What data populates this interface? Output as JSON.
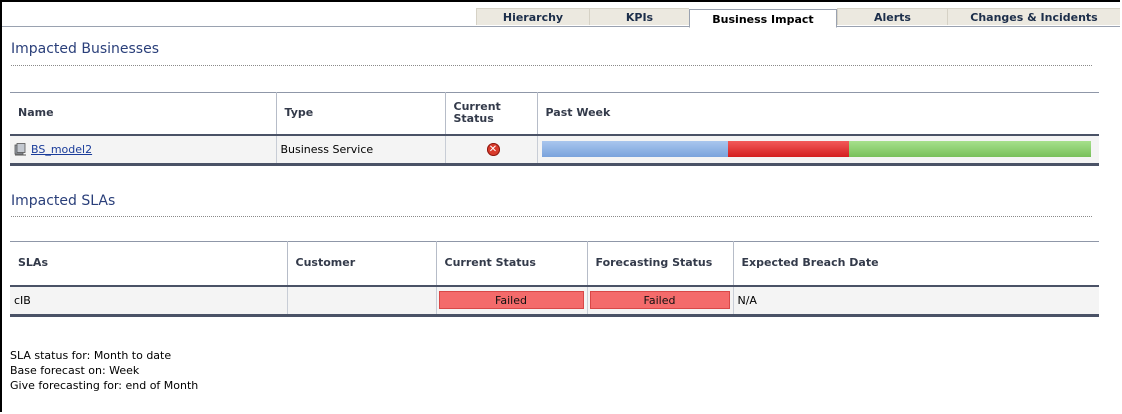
{
  "tabs": [
    {
      "label": "Hierarchy",
      "active": false
    },
    {
      "label": "KPIs",
      "active": false
    },
    {
      "label": "Business Impact",
      "active": true
    },
    {
      "label": "Alerts",
      "active": false
    },
    {
      "label": "Changes & Incidents",
      "active": false
    }
  ],
  "businesses": {
    "title": "Impacted Businesses",
    "columns": {
      "name": "Name",
      "type": "Type",
      "current_status": "Current Status",
      "past_week": "Past Week"
    },
    "rows": [
      {
        "name": "BS_model2",
        "type": "Business Service",
        "current_status_icon": "failed-x-icon",
        "past_week": [
          {
            "status": "blue",
            "fraction": 0.34
          },
          {
            "status": "red",
            "fraction": 0.22
          },
          {
            "status": "green",
            "fraction": 0.44
          }
        ]
      }
    ]
  },
  "slas": {
    "title": "Impacted SLAs",
    "columns": {
      "slas": "SLAs",
      "customer": "Customer",
      "current_status": "Current Status",
      "forecasting_status": "Forecasting Status",
      "expected_breach_date": "Expected Breach Date"
    },
    "rows": [
      {
        "sla": "cIB",
        "customer": "",
        "current_status": "Failed",
        "forecasting_status": "Failed",
        "expected_breach_date": "N/A"
      }
    ]
  },
  "footer": {
    "line1": "SLA status for: Month to date",
    "line2": "Base forecast on: Week",
    "line3": "Give forecasting for: end of Month"
  },
  "colors": {
    "failed": "#f46b6b",
    "status_blue": "#8fb3e4",
    "status_red": "#e02b2b",
    "status_green": "#8fd070"
  }
}
